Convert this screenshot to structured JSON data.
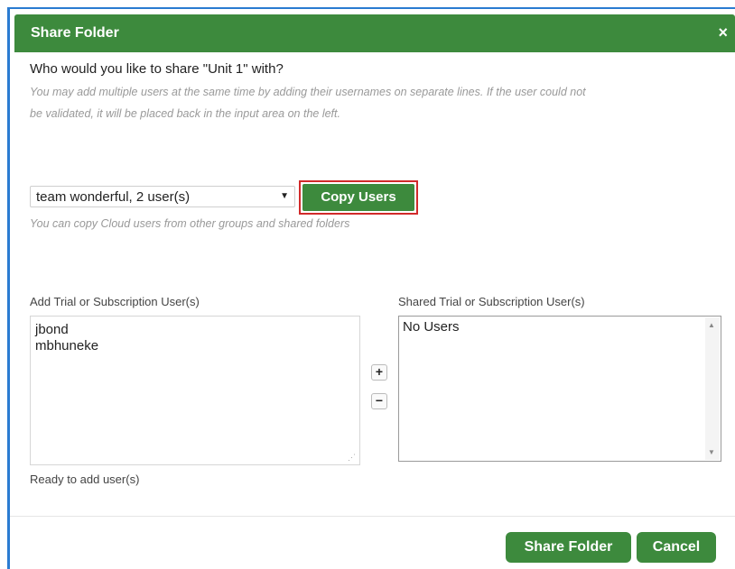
{
  "dialog": {
    "title": "Share Folder",
    "close_label": "×"
  },
  "prompt": {
    "question": "Who would you like to share \"Unit 1\" with?",
    "hint_line1": "You may add multiple users at the same time by adding their usernames on separate lines. If the user could not",
    "hint_line2": "be validated, it will be placed back in the input area on the left."
  },
  "copy": {
    "selected_group": "team wonderful, 2 user(s)",
    "button_label": "Copy Users",
    "hint": "You can copy Cloud users from other groups and shared folders"
  },
  "add_users": {
    "label": "Add Trial or Subscription User(s)",
    "lines": [
      "jbond",
      "mbhuneke"
    ],
    "status": "Ready to add user(s)"
  },
  "shared_users": {
    "label": "Shared Trial or Subscription User(s)",
    "lines": [
      "No Users"
    ]
  },
  "controls": {
    "add_symbol": "+",
    "remove_symbol": "−"
  },
  "footer": {
    "share_label": "Share Folder",
    "cancel_label": "Cancel"
  },
  "colors": {
    "accent_green": "#3d8a3d",
    "highlight_red": "#d12a2a",
    "frame_blue": "#2a7bd1"
  }
}
